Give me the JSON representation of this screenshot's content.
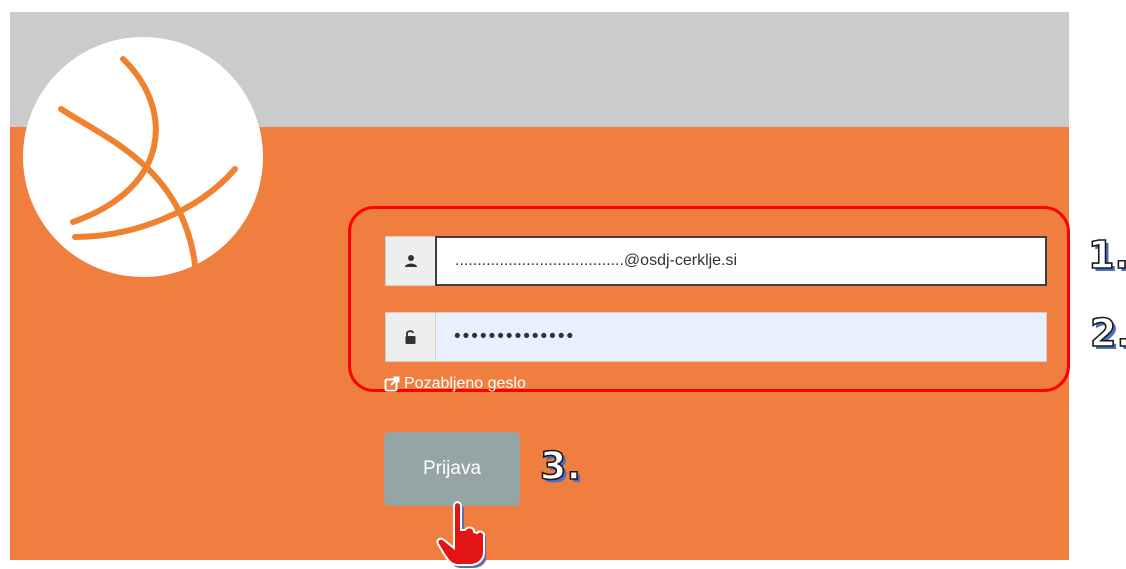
{
  "login_form": {
    "email_value": "......................................@osdj-cerklje.si",
    "password_value": "••••••••••••••",
    "forgot_password_label": "Pozabljeno geslo",
    "login_button_label": "Prijava"
  },
  "icons": {
    "email_addon": "user-icon",
    "password_addon": "unlock-icon",
    "forgot_link": "external-link-icon",
    "cursor": "pointer-hand-icon"
  },
  "annotations": {
    "step1": "1.",
    "step2": "2.",
    "step3": "3."
  },
  "colors": {
    "orange_background": "#ef7e3f",
    "gray_header": "#cbcbcb",
    "login_button": "#95a5a6",
    "highlight_border": "#ff0000",
    "logo_stroke": "#f0822f"
  }
}
